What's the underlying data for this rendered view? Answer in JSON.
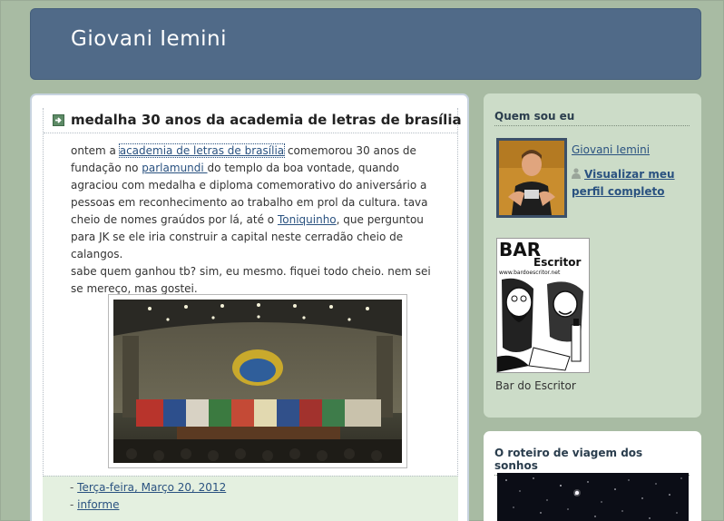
{
  "blog": {
    "title": "Giovani Iemini"
  },
  "post": {
    "title": "medalha 30 anos da academia de letras de brasília",
    "body": {
      "p1_before_link1": "ontem a ",
      "link1": "academia de letras de brasília",
      "p1_after_link1": " comemorou 30 anos de fundação no ",
      "link2": "parlamundi ",
      "p1_after_link2": "do templo da boa vontade, quando agraciou com medalha e diploma comemorativo do aniversário a pessoas em reconhecimento ao trabalho em prol da cultura. tava cheio de nomes graúdos por lá, até o ",
      "link3": "Toniquinho",
      "p1_end": ", que perguntou para JK se ele iria construir a capital neste cerradão cheio de calangos.",
      "p2": "sabe quem ganhou tb? sim, eu mesmo. fiquei todo cheio. nem sei se mereço, mas gostei."
    },
    "footer": {
      "dash": "- ",
      "date": "Terça-feira, Março 20, 2012",
      "label": "informe"
    }
  },
  "sidebar": {
    "about": {
      "title": "Quem sou eu",
      "name": "Giovani Iemini",
      "profile_link": "Visualizar meu perfil completo"
    },
    "banner": {
      "caption": "Bar do Escritor",
      "logo_text": "BAR",
      "logo_subtext": "Escritor",
      "logo_url_text": "www.bardoescritor.net"
    },
    "roteiro": {
      "title": "O roteiro de viagem dos sonhos"
    }
  },
  "icons": {
    "post_arrow": "arrow-right-icon",
    "profile": "person-icon"
  },
  "colors": {
    "background": "#a8bba3",
    "header": "#506a88",
    "sidebar_panel": "#ccdcc8",
    "footer": "#e4f0e0",
    "link": "#2a5280"
  }
}
